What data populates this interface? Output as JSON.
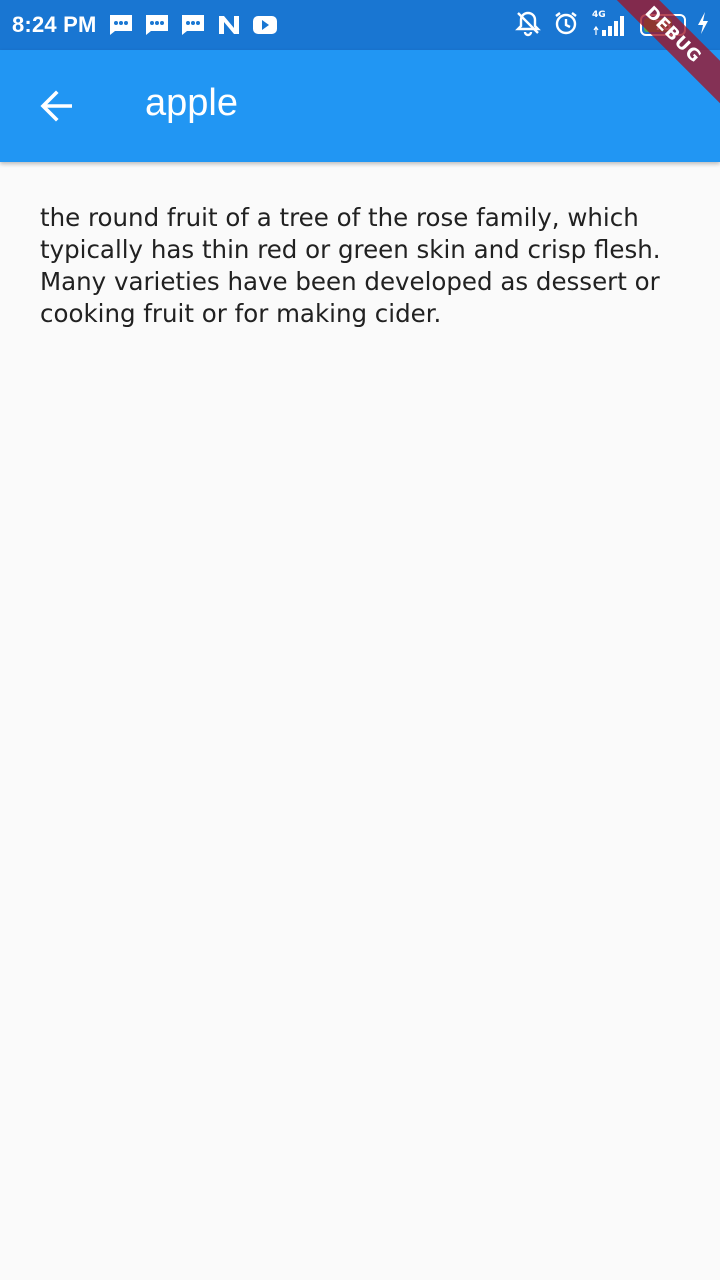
{
  "status_bar": {
    "time": "8:24 PM",
    "network": "4G",
    "battery_level": "73",
    "battery_fraction": 0.73,
    "icons_left": [
      "message-icon",
      "message-icon",
      "message-icon",
      "n-app-icon",
      "youtube-icon"
    ],
    "icons_right": [
      "mute-icon",
      "alarm-icon",
      "signal-icon",
      "battery-icon",
      "charging-icon"
    ]
  },
  "app_bar": {
    "title": "apple",
    "back_icon": "back-arrow-icon",
    "color": "#2196f3"
  },
  "content": {
    "definition": "the round fruit of a tree of the rose family, which typically has thin red or green skin and crisp flesh. Many varieties have been developed as dessert or cooking fruit or for making cider."
  },
  "debug_banner": {
    "label": "DEBUG"
  }
}
